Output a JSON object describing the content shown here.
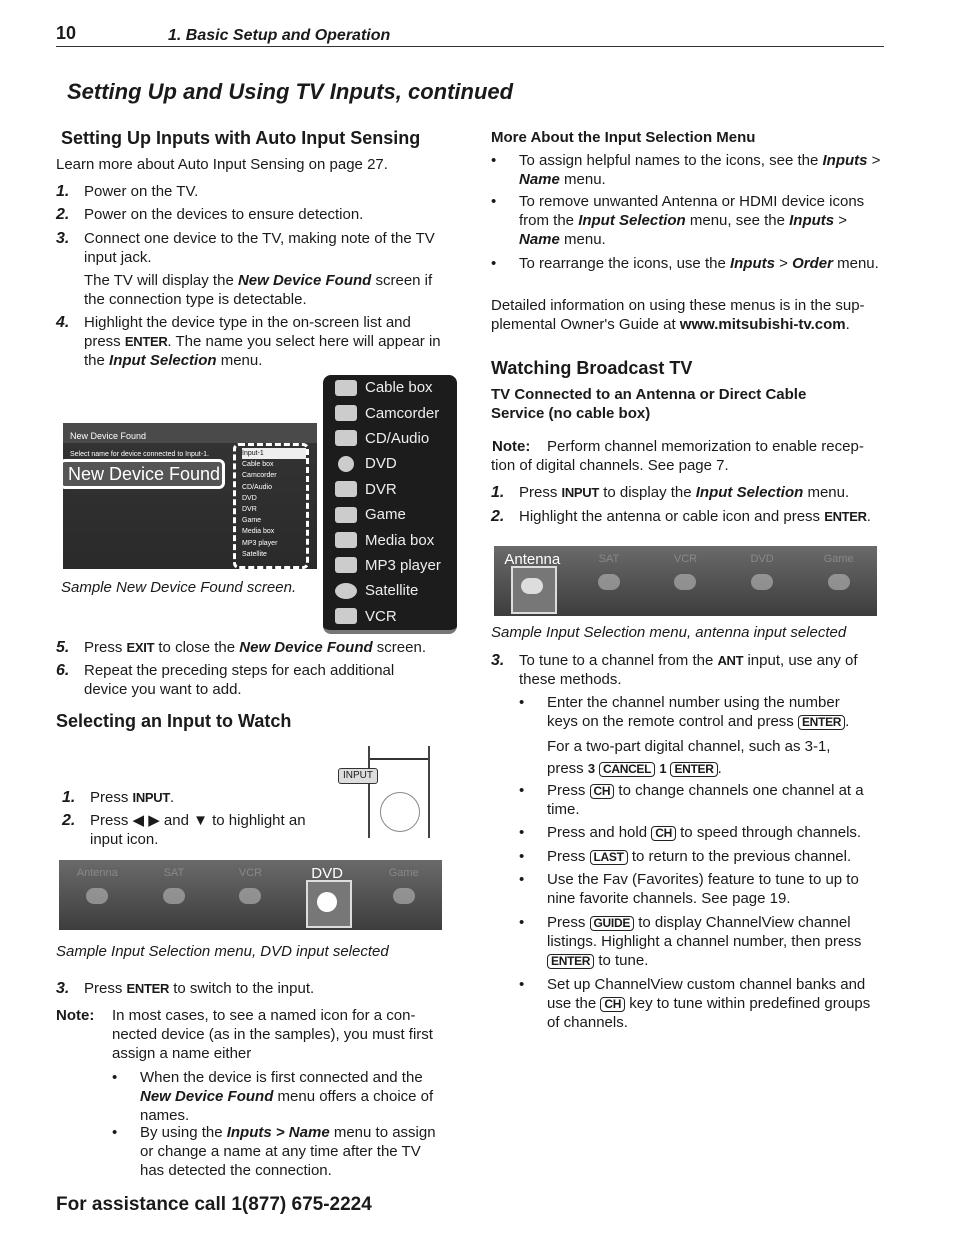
{
  "header": {
    "page_number": "10",
    "section": "1. Basic Setup and Operation"
  },
  "title": "Setting Up and Using TV Inputs, continued",
  "auto": {
    "heading": "Setting Up Inputs with Auto Input Sensing",
    "intro": "Learn more about Auto Input Sensing on page 27.",
    "steps": [
      {
        "n": "1.",
        "text": "Power on the TV."
      },
      {
        "n": "2.",
        "text": "Power on the devices to ensure detection."
      },
      {
        "n": "3.",
        "text": "Connect one device to the TV, making note of the TV input jack."
      },
      {
        "n": "4.",
        "a": "Highlight the device type in the on-screen list and press ",
        "key": "ENTER",
        "b": ".  The name you select here will appear in the ",
        "em": "Input Selection",
        "c": " menu."
      }
    ],
    "note3": {
      "a": "The TV will display the ",
      "em": "New Device Found",
      "b": " screen if the connection type is detectable."
    },
    "screen": {
      "title": "New Device Found",
      "prompt": "Select name for device connected to Input-1.",
      "callout": "New Device Found",
      "list": [
        "Input-1",
        "Cable box",
        "Camcorder",
        "CD/Audio",
        "DVD",
        "DVR",
        "Game",
        "Media box",
        "MP3 player",
        "Satellite"
      ]
    },
    "caption": "Sample New Device Found screen.",
    "icon_list": [
      "Cable box",
      "Camcorder",
      "CD/Audio",
      "DVD",
      "DVR",
      "Game",
      "Media box",
      "MP3 player",
      "Satellite",
      "VCR"
    ],
    "step5": {
      "n": "5.",
      "a": "Press ",
      "key": "EXIT",
      "b": " to close the ",
      "em": "New Device Found",
      "c": " screen."
    },
    "step6": {
      "n": "6.",
      "text": "Repeat the preceding steps for each  additional device you want to add."
    }
  },
  "select": {
    "heading": "Selecting an Input to Watch",
    "remote_label": "INPUT",
    "step1": {
      "n": "1.",
      "a": "Press ",
      "key": "INPUT",
      "b": "."
    },
    "step2": {
      "n": "2.",
      "text": "Press ◀ ▶ and ▼ to highlight an input icon."
    },
    "bar": [
      "Antenna",
      "SAT",
      "VCR",
      "DVD",
      "Game"
    ],
    "caption": "Sample Input Selection menu, DVD input selected",
    "step3": {
      "n": "3.",
      "a": "Press ",
      "key": "ENTER",
      "b": " to switch to the input."
    },
    "note": {
      "label": "Note:",
      "text": "In most cases, to see a named icon for a con-nected device (as in the samples), you must first assign a name either"
    },
    "bullets": [
      {
        "a": "When the device is first connected and the ",
        "em": "New Device Found",
        "b": " menu offers a choice of names."
      },
      {
        "a": "By using the ",
        "em": "Inputs > Name",
        "b": " menu to assign or change a name at any time after the TV has detected the connection."
      }
    ]
  },
  "more": {
    "heading": "More About the Input Selection Menu",
    "b1": {
      "a": "To assign helpful names to the icons, see the ",
      "em1": "Inputs",
      "sep": " > ",
      "em2": "Name",
      "b": " menu."
    },
    "b2": {
      "a": "To remove unwanted Antenna or HDMI device icons from the ",
      "em1": "Input Selection",
      "b": " menu, see the ",
      "em2": "Inputs",
      "sep": " > ",
      "em3": "Name",
      "c": " menu."
    },
    "b3": {
      "a": "To rearrange the icons, use the ",
      "em1": "Inputs",
      "sep": " > ",
      "em2": "Order",
      "b": " menu."
    },
    "detail": {
      "a": "Detailed information on using these menus is in the sup-plemental Owner's Guide at ",
      "link": "www.mitsubishi-tv.com",
      "b": "."
    }
  },
  "broadcast": {
    "heading": "Watching Broadcast TV",
    "sub": "TV Connected to an Antenna or Direct Cable Service (no cable box)",
    "note": {
      "label": "Note:",
      "text": "Perform channel memorization to enable recep-tion of digital channels.  See page 7."
    },
    "step1": {
      "n": "1.",
      "a": "Press ",
      "key": "INPUT",
      "b": " to display the ",
      "em": "Input Selection",
      "c": " menu."
    },
    "step2": {
      "n": "2.",
      "a": "Highlight the antenna or cable icon and press ",
      "key": "ENTER",
      "b": "."
    },
    "bar": [
      "Antenna",
      "SAT",
      "VCR",
      "DVD",
      "Game"
    ],
    "caption": "Sample Input Selection menu, antenna input selected",
    "step3": {
      "n": "3.",
      "a": "To tune to a channel from the ",
      "key": "ANT",
      "b": " input, use any of these methods."
    },
    "bullets": {
      "b1a": "Enter the channel number using the number keys on the remote control and press ",
      "b1b": "For a two-part digital channel, such as 3-1, press ",
      "b1c": "3",
      "b1d": "1",
      "b2a": "Press ",
      "b2b": " to change channels one channel at a time.",
      "b3a": "Press and hold ",
      "b3b": " to speed through channels.",
      "b4a": "Press ",
      "b4b": "  to return to the previous channel.",
      "b5": "Use the Fav (Favorites) feature to tune to up to nine favorite channels.  See page 19.",
      "b6a": "Press ",
      "b6b": " to display ChannelView channel listings.  Highlight a channel number, then press ",
      "b6c": " to tune.",
      "b7a": "Set up ChannelView custom channel banks and use the ",
      "b7b": " key to tune within predefined groups of channels."
    },
    "keys": {
      "enter": "ENTER",
      "cancel": "CANCEL",
      "ch": "CH",
      "last": "LAST",
      "guide": "GUIDE"
    }
  },
  "footer": "For assistance call 1(877) 675-2224"
}
